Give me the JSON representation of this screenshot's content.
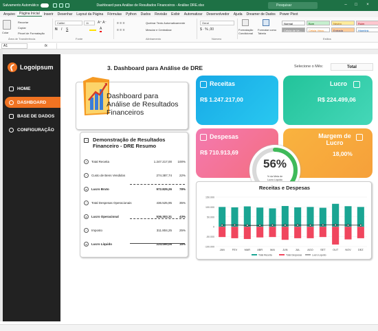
{
  "titlebar": {
    "autosave": "Salvamento Automático",
    "doc_title": "Dashboard para Análise de Resultados Financeiros - Análise DRE.xlsx",
    "search": "Pesquisar"
  },
  "menu": [
    "Arquivo",
    "Página Inicial",
    "Inserir",
    "Desenhar",
    "Layout da Página",
    "Fórmulas",
    "Python",
    "Dados",
    "Revisão",
    "Exibir",
    "Automatizar",
    "Desenvolvedor",
    "Ajuda",
    "Dreamer de Dados",
    "Power Pivot"
  ],
  "ribbon": {
    "paste": "Colar",
    "cut": "Recortar",
    "copy": "Copiar",
    "painter": "Pincel de Formatação",
    "clipboard": "Área de Transferência",
    "font_name": "Calibri",
    "font_size": "11",
    "font_group": "Fonte",
    "wrap": "Quebrar Texto Automaticamente",
    "merge": "Mesclar e Centralizar",
    "align_group": "Alinhamento",
    "number_format": "Geral",
    "number_group": "Número",
    "cond_format": "Formatação Condicional",
    "format_table": "Formatar como Tabela",
    "styles": [
      "Normal",
      "Bom",
      "Neutro",
      "Ruim",
      "Célula de Ve...",
      "Célula Vincu...",
      "Entrada",
      "Hiperlink"
    ],
    "styles_group": "Estilos"
  },
  "formula": {
    "cell": "A1",
    "fx": "fx"
  },
  "sidebar": {
    "logo": "Logoipsum",
    "items": [
      {
        "label": "HOME"
      },
      {
        "label": "DASHBOARD"
      },
      {
        "label": "BASE DE DADOS"
      },
      {
        "label": "CONFIGURAÇÃO"
      }
    ]
  },
  "header": {
    "title": "3. Dashboard para Análise de DRE",
    "month_label": "Selecione o Mês:",
    "month_value": "Total"
  },
  "hero": {
    "line1": "Dashboard para",
    "line2": "Análise de Resultados",
    "line3": "Financeiros"
  },
  "dre": {
    "title1": "Demonstração de Resultados",
    "title2": "Financeiro - DRE Resumo",
    "rows": [
      {
        "label": "Total Receita",
        "value": "1.247.217,00",
        "pct": "100%",
        "icon": "+"
      },
      {
        "label": "Custo de Bens Vendidos",
        "value": "274.387,74",
        "pct": "22%",
        "icon": "−"
      },
      {
        "label": "Lucro Bruto",
        "value": "972.829,26",
        "pct": "78%",
        "icon": "="
      },
      {
        "label": "Total Despesas Operacionais",
        "value": "436.525,95",
        "pct": "35%",
        "icon": "−"
      },
      {
        "label": "Lucro Operacional",
        "value": "536.303,31",
        "pct": "43%",
        "icon": "="
      },
      {
        "label": "Imposto",
        "value": "311.804,25",
        "pct": "25%",
        "icon": "−"
      },
      {
        "label": "Lucro Líquido",
        "value": "224.499,06",
        "pct": "18%",
        "icon": "="
      }
    ]
  },
  "cards": {
    "receitas": {
      "title": "Receitas",
      "value": "R$ 1.247.217,00",
      "color": "#1ab6e8"
    },
    "lucro": {
      "title": "Lucro",
      "value": "R$ 224.499,06",
      "color": "#2ec9a6"
    },
    "despesas": {
      "title": "Despesas",
      "value": "R$ 710.913,69",
      "color": "#f0607d"
    },
    "margem": {
      "title1": "Margem de",
      "title2": "Lucro",
      "value": "18,00%",
      "color": "#f6a53a"
    }
  },
  "gauge": {
    "value": "56%",
    "pct": 0.56,
    "caption1": "% da Meta de",
    "caption2": "Lucro Líquido"
  },
  "chart_data": {
    "type": "bar",
    "title": "Receitas e Despesas",
    "categories": [
      "JAN",
      "FEV",
      "MAR",
      "ABR",
      "MAI",
      "JUN",
      "JUL",
      "AGO",
      "SET",
      "OUT",
      "NOV",
      "DEZ"
    ],
    "ylim": [
      -100000,
      150000
    ],
    "yticks": [
      "150.000",
      "100.000",
      "50.000",
      "0",
      "-50.000",
      "-100.000"
    ],
    "series": [
      {
        "name": "Total Receita",
        "color": "#1aa593",
        "values": [
          100000,
          98000,
          103000,
          97000,
          93000,
          105000,
          98000,
          100000,
          96000,
          116000,
          104000,
          100000
        ]
      },
      {
        "name": "Total Despesas",
        "color": "#f0465e",
        "values": [
          -52000,
          -58000,
          -62000,
          -54000,
          -52000,
          -66000,
          -58000,
          -58000,
          -52000,
          -90000,
          -64000,
          -58000
        ]
      },
      {
        "name": "Lucro Líquido",
        "color": "#222222",
        "values": [
          8000,
          9000,
          7000,
          7000,
          8000,
          8000,
          8000,
          8000,
          9000,
          9000,
          8000,
          8000
        ]
      }
    ]
  }
}
